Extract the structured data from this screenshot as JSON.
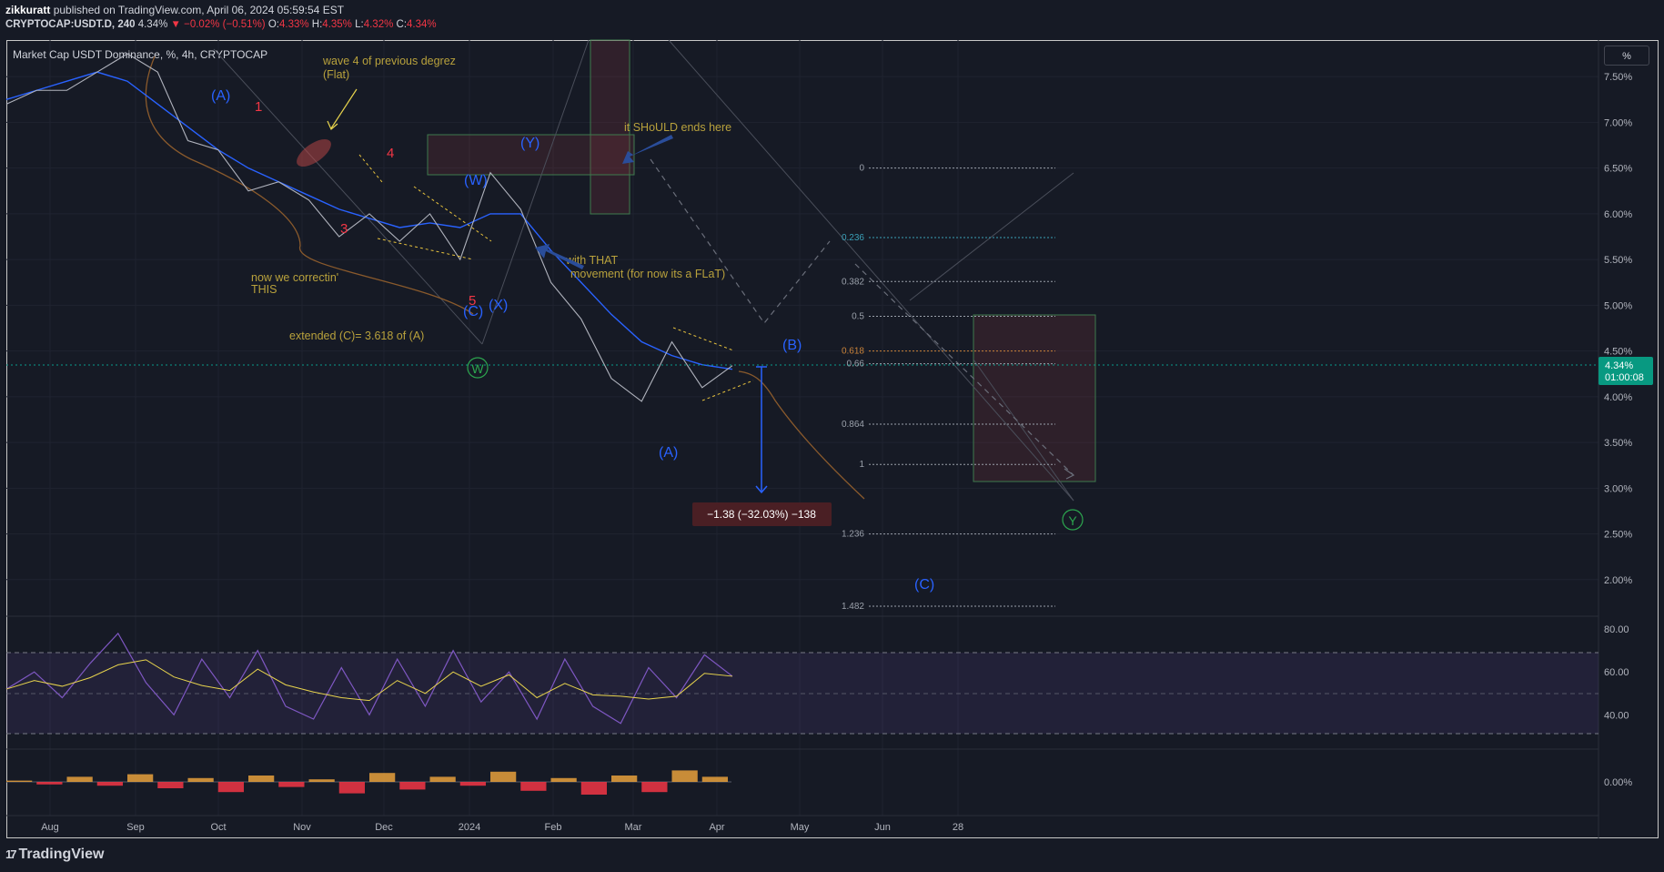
{
  "header": {
    "author": "zikkuratt",
    "published": "published on TradingView.com, April 06, 2024 05:59:54 EST",
    "symbol": "CRYPTOCAP:USDT.D, 240",
    "last": "4.34%",
    "change": "−0.02% (−0.51%)",
    "o_label": "O:",
    "o_val": "4.33%",
    "h_label": "H:",
    "h_val": "4.35%",
    "l_label": "L:",
    "l_val": "4.32%",
    "c_label": "C:",
    "c_val": "4.34%"
  },
  "legend_title": "Market Cap USDT Dominance, %, 4h, CRYPTOCAP",
  "scale_button": "%",
  "price_badge": {
    "value": "4.34%",
    "countdown": "01:00:08"
  },
  "brand": "TradingView",
  "colors": {
    "background": "#161a25",
    "ma_line": "#2962ff",
    "rsi_line": "#7e57c2",
    "rsi_signal": "#e8d44d",
    "badge": "#089981",
    "annotation": "#b8a13c"
  },
  "chart_data": {
    "type": "line",
    "y_unit": "%",
    "x_axis_labels": [
      "Aug",
      "Sep",
      "Oct",
      "Nov",
      "Dec",
      "2024",
      "Feb",
      "Mar",
      "Apr",
      "May",
      "Jun",
      "28"
    ],
    "price_axis_ticks": [
      "7.50%",
      "7.00%",
      "6.50%",
      "6.00%",
      "5.50%",
      "5.00%",
      "4.50%",
      "4.00%",
      "3.50%",
      "3.00%",
      "2.50%",
      "2.00%"
    ],
    "ylim": [
      1.6,
      7.9
    ],
    "series": [
      {
        "values": [
          7.2,
          7.35,
          7.35,
          7.55,
          7.75,
          7.55,
          6.8,
          6.7,
          6.25,
          6.35,
          6.15,
          5.75,
          6.0,
          5.7,
          6.0,
          5.5,
          6.45,
          6.05,
          5.25,
          4.85,
          4.2,
          3.95,
          4.6,
          4.1,
          4.34
        ]
      }
    ],
    "moving_average": [
      7.25,
      7.35,
      7.45,
      7.55,
      7.45,
      7.2,
      6.95,
      6.7,
      6.5,
      6.35,
      6.2,
      6.05,
      5.95,
      5.85,
      5.9,
      5.85,
      6.0,
      6.0,
      5.6,
      5.25,
      4.9,
      4.6,
      4.45,
      4.35,
      4.3
    ],
    "fib_levels": [
      {
        "label": "0",
        "value": 6.5
      },
      {
        "label": "0.236",
        "value": 5.74
      },
      {
        "label": "0.382",
        "value": 5.26
      },
      {
        "label": "0.5",
        "value": 4.88
      },
      {
        "label": "0.618",
        "value": 4.5
      },
      {
        "label": "0.66",
        "value": 4.36
      },
      {
        "label": "0.864",
        "value": 3.7
      },
      {
        "label": "1",
        "value": 3.26
      },
      {
        "label": "1.236",
        "value": 2.5
      },
      {
        "label": "1.482",
        "value": 1.71
      }
    ],
    "measure_label": "−1.38 (−32.03%) −138",
    "wave_labels": [
      "(A)",
      "1",
      "3",
      "4",
      "5",
      "(C)",
      "(W)",
      "(X)",
      "(Y)",
      "(A)",
      "(B)",
      "(C)",
      "W",
      "Y"
    ],
    "annotations": [
      "wave 4 of previous degrez\n(Flat)",
      "it SHoULD ends here",
      "with THAT\nmovement (for now its a FLaT)",
      "now we correctin'\nTHIS",
      "extended (C)= 3.618 of (A)"
    ],
    "rsi": {
      "axis_ticks": [
        "80.00",
        "60.00",
        "40.00"
      ],
      "ylim": [
        24,
        86
      ],
      "overbought": 70,
      "middle": 50,
      "oversold": 30,
      "values": [
        52,
        60,
        48,
        64,
        78,
        55,
        40,
        66,
        48,
        70,
        44,
        38,
        62,
        40,
        66,
        44,
        70,
        46,
        60,
        38,
        66,
        44,
        36,
        62,
        48,
        68,
        58
      ]
    },
    "momentum": {
      "axis_ticks": [
        "0.00%"
      ],
      "values": [
        0.1,
        -0.2,
        0.4,
        -0.3,
        0.6,
        -0.5,
        0.3,
        -0.8,
        0.5,
        -0.4,
        0.2,
        -0.9,
        0.7,
        -0.6,
        0.4,
        -0.3,
        0.8,
        -0.7,
        0.3,
        -1.0,
        0.5,
        -0.8,
        0.9,
        0.4
      ]
    }
  }
}
